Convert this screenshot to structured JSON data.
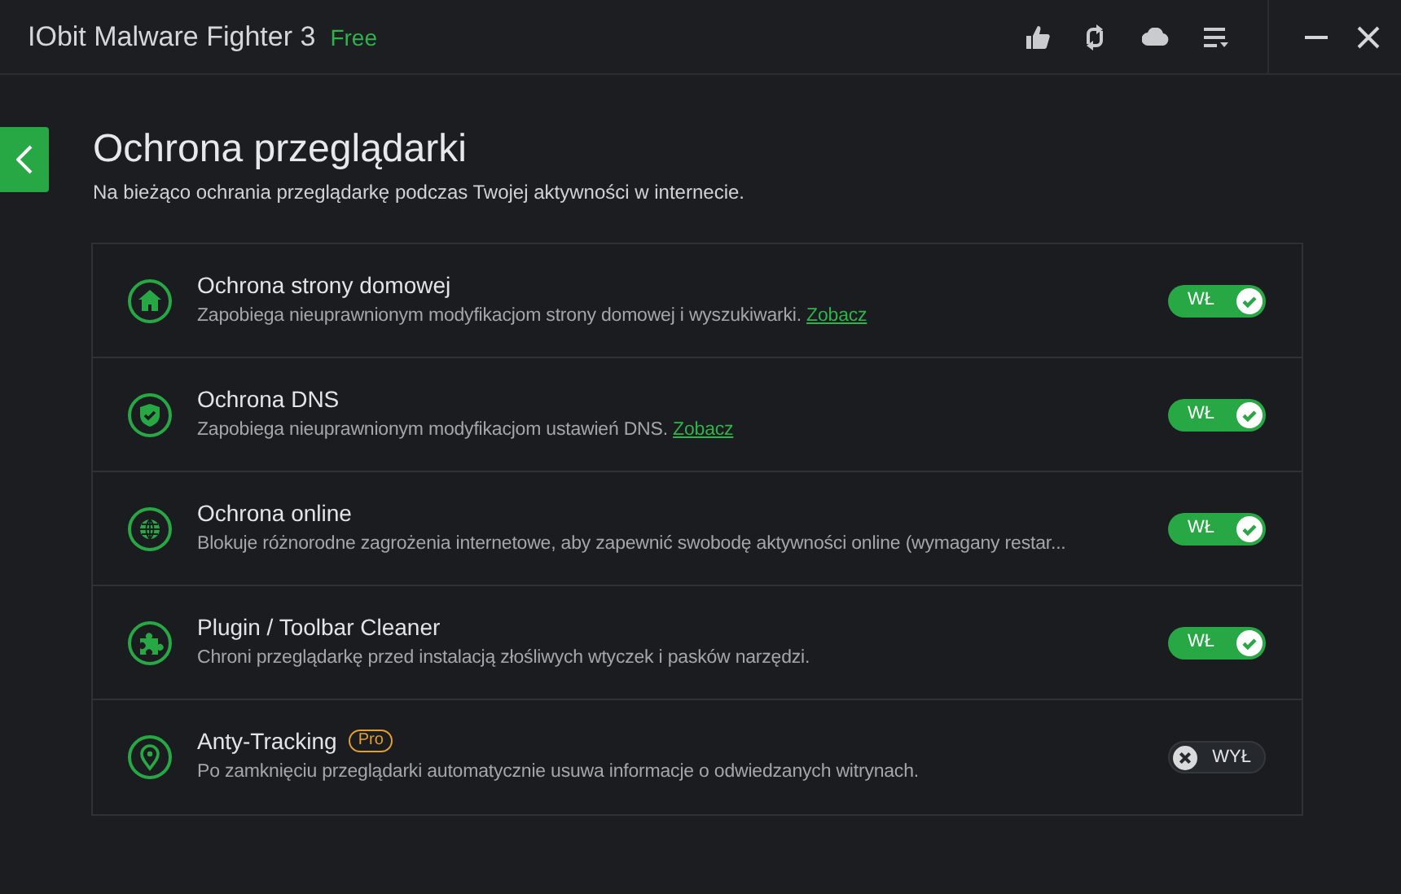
{
  "window": {
    "title": "IObit Malware Fighter 3",
    "edition": "Free"
  },
  "page": {
    "title": "Ochrona przeglądarki",
    "subtitle": "Na bieżąco ochrania przeglądarkę podczas Twojej aktywności w internecie."
  },
  "features": [
    {
      "title": "Ochrona strony domowej",
      "description": "Zapobiega nieuprawnionym modyfikacjom strony domowej i wyszukiwarki.",
      "link": "Zobacz",
      "on": true,
      "toggle_label": "WŁ"
    },
    {
      "title": "Ochrona DNS",
      "description": "Zapobiega nieuprawnionym modyfikacjom ustawień DNS.",
      "link": "Zobacz",
      "on": true,
      "toggle_label": "WŁ"
    },
    {
      "title": "Ochrona online",
      "description": "Blokuje różnorodne zagrożenia internetowe, aby zapewnić swobodę aktywności online (wymagany restar...",
      "on": true,
      "toggle_label": "WŁ"
    },
    {
      "title": "Plugin / Toolbar Cleaner",
      "description": "Chroni przeglądarkę przed instalacją złośliwych wtyczek i pasków narzędzi.",
      "on": true,
      "toggle_label": "WŁ"
    },
    {
      "title": "Anty-Tracking",
      "badge": "Pro",
      "description": "Po zamknięciu przeglądarki automatycznie usuwa informacje o odwiedzanych witrynach.",
      "on": false,
      "toggle_label": "WYŁ"
    }
  ]
}
